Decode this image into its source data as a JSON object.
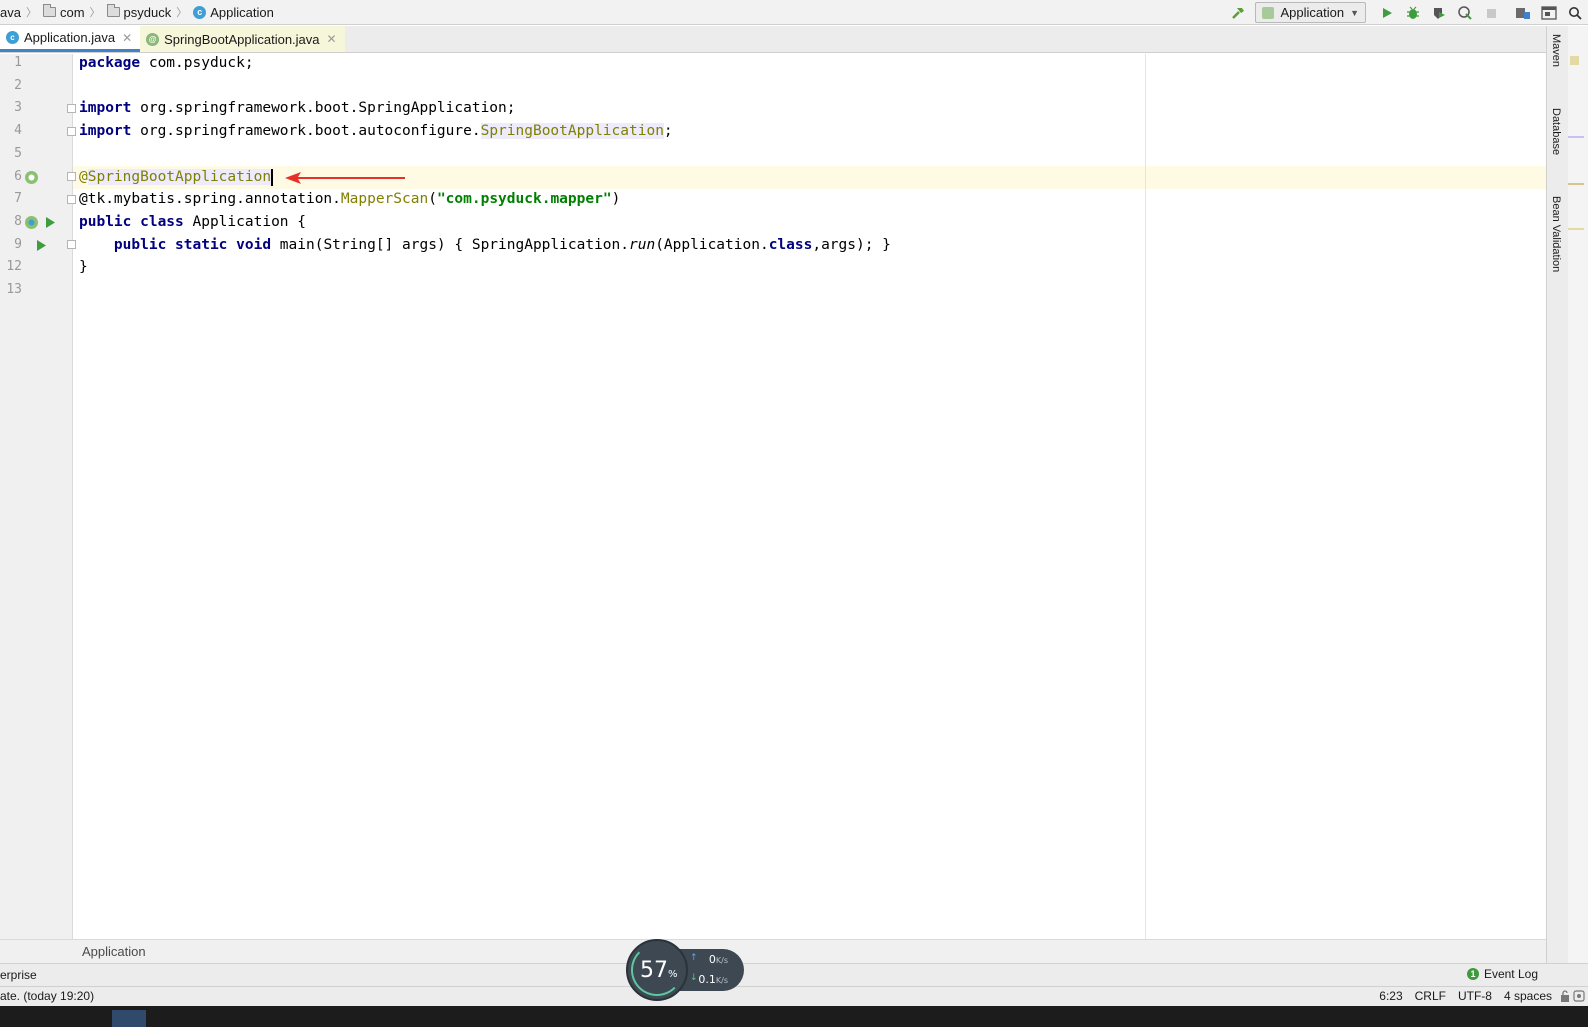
{
  "navbar": {
    "crumbs": [
      "ava",
      "com",
      "psyduck",
      "Application"
    ]
  },
  "toolbar": {
    "run_config": "Application"
  },
  "tabs": [
    {
      "label": "Application.java",
      "active": true
    },
    {
      "label": "SpringBootApplication.java",
      "active": false
    }
  ],
  "editor": {
    "line_numbers": [
      "1",
      "2",
      "3",
      "4",
      "5",
      "6",
      "7",
      "8",
      "9",
      "12",
      "13"
    ],
    "lines": {
      "l1_kw": "package",
      "l1_rest": " com.psyduck;",
      "l3_kw": "import",
      "l3_rest": " org.springframework.boot.SpringApplication;",
      "l4_kw": "import",
      "l4_rest": " org.springframework.boot.autoconfigure.",
      "l4_ref": "SpringBootApplication",
      "l4_end": ";",
      "l6_at": "@",
      "l6_ann": "SpringBootApplication",
      "l7_start": "@tk.mybatis.spring.annotation.",
      "l7_ann": "MapperScan",
      "l7_open": "(",
      "l7_str": "\"com.psyduck.mapper\"",
      "l7_close": ")",
      "l8_kw": "public class",
      "l8_rest": " Application {",
      "l9_indent": "    ",
      "l9_kw": "public static void",
      "l9_rest": " main(String[] args) { SpringApplication.",
      "l9_run": "run",
      "l9_mid": "(Application.",
      "l9_cls": "class",
      "l9_end": ",args); }",
      "l12": "}"
    }
  },
  "right_strip": {
    "tabs": [
      "Maven",
      "Database",
      "Bean Validation"
    ]
  },
  "footer_breadcrumb": "Application",
  "toolwindow_bar": {
    "left": "erprise",
    "event_log": "Event Log",
    "event_count": "1"
  },
  "statusbar": {
    "message": "ate. (today 19:20)",
    "position": "6:23",
    "line_sep": "CRLF",
    "encoding": "UTF-8",
    "indent": "4 spaces"
  },
  "net_widget": {
    "percent": "57",
    "percent_unit": "%",
    "up": "0",
    "down": "0.1",
    "unit": "K/s"
  },
  "colors": {
    "keyword": "#000080",
    "annotation": "#808000",
    "string": "#008000",
    "caret_row": "#fffae3",
    "tab_accent": "#4083c9"
  }
}
